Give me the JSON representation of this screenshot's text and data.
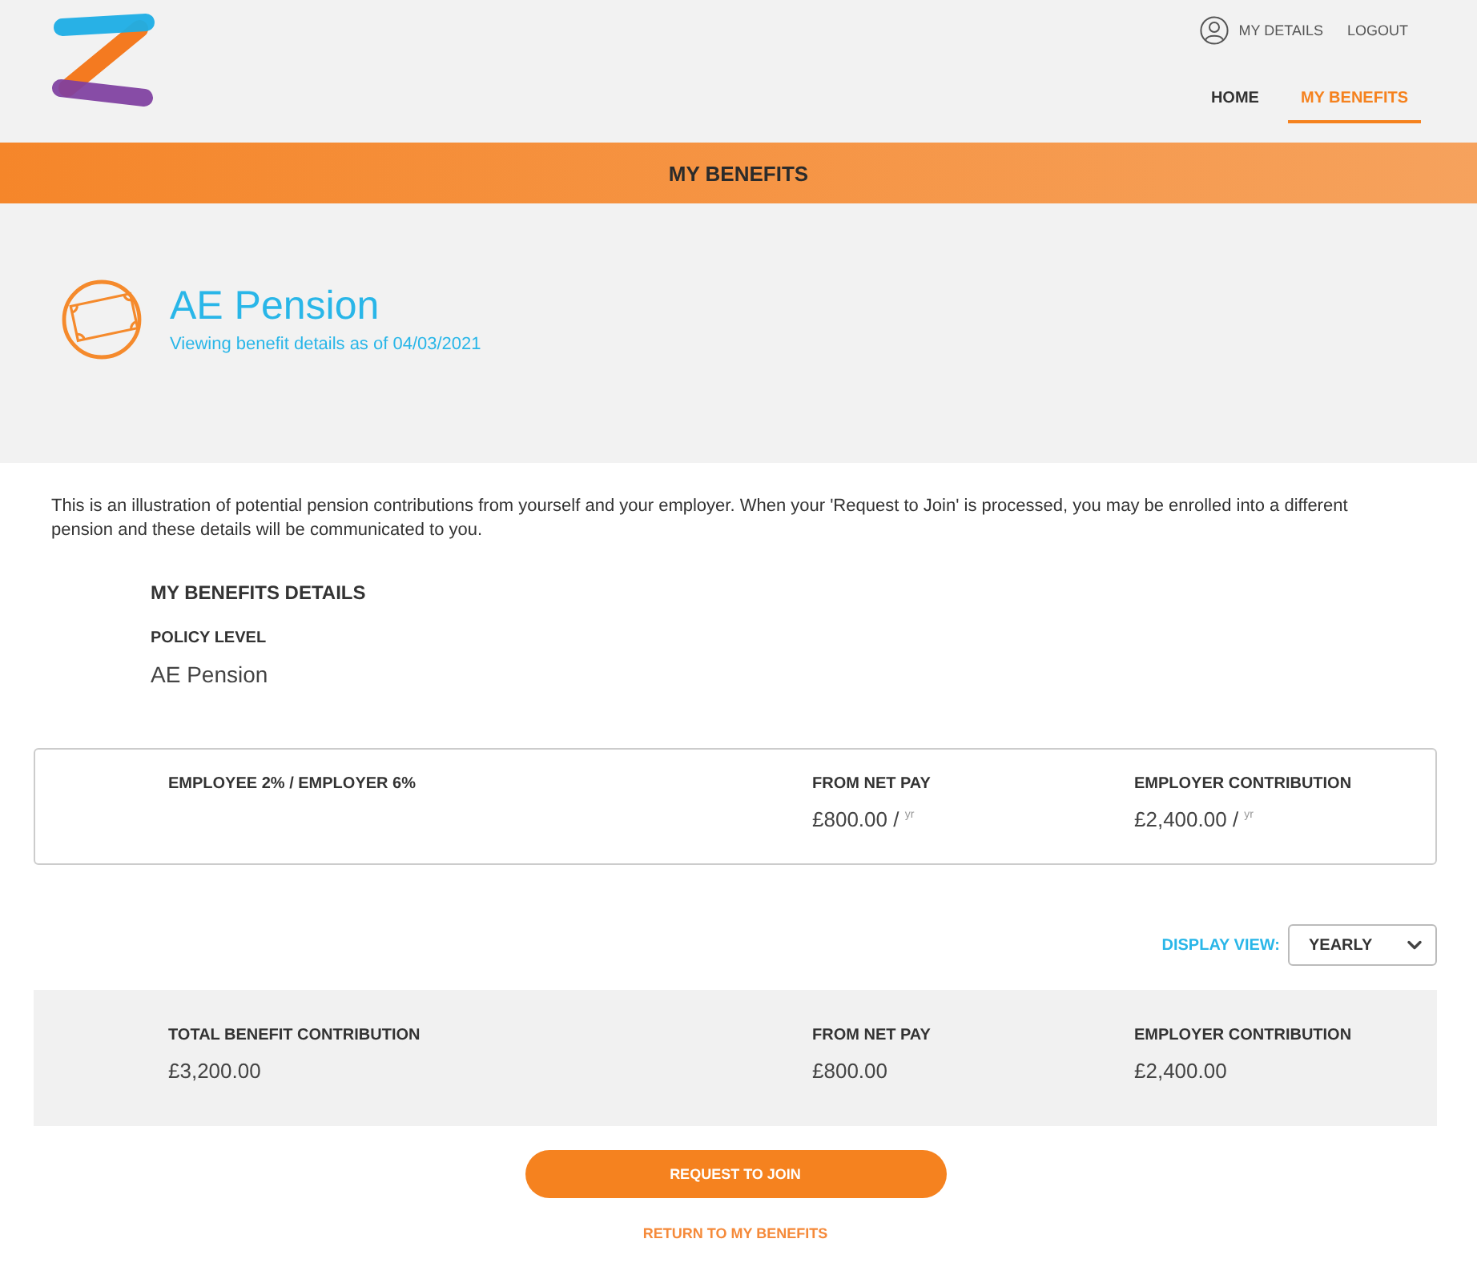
{
  "header": {
    "links": [
      {
        "label": "MY DETAILS",
        "kind": "account"
      },
      {
        "label": "LOGOUT",
        "kind": "plain"
      }
    ],
    "nav": [
      {
        "label": "HOME",
        "selected": false
      },
      {
        "label": "MY BENEFITS",
        "selected": true
      }
    ]
  },
  "banner": {
    "title": "MY BENEFITS"
  },
  "hero": {
    "title": "AE Pension",
    "subtitle": "Viewing benefit details as of 04/03/2021"
  },
  "intro": "This is an illustration of potential pension contributions from yourself and your employer. When your 'Request to Join' is processed, you may be enrolled into a different pension and these details will be communicated to you.",
  "details": {
    "heading": "MY BENEFITS DETAILS",
    "fields": [
      {
        "label": "POLICY LEVEL",
        "value": "AE Pension"
      }
    ]
  },
  "contribution_card": {
    "title": "EMPLOYEE 2% / EMPLOYER 6%",
    "columns": [
      {
        "label": "FROM NET PAY",
        "value": "£800.00 / $^{yr}$"
      },
      {
        "label": "EMPLOYER CONTRIBUTION",
        "value": "£2,400.00 / $^{yr}$"
      }
    ]
  },
  "display_view": {
    "label": "DISPLAY VIEW:",
    "value": "YEARLY"
  },
  "totals": [
    {
      "label": "TOTAL BENEFIT CONTRIBUTION",
      "value": "£3,200.00"
    },
    {
      "label": "FROM NET PAY",
      "value": "£800.00"
    },
    {
      "label": "EMPLOYER CONTRIBUTION",
      "value": "£2,400.00"
    }
  ],
  "actions": {
    "primary": "REQUEST TO JOIN",
    "secondary": "RETURN TO MY BENEFITS"
  }
}
